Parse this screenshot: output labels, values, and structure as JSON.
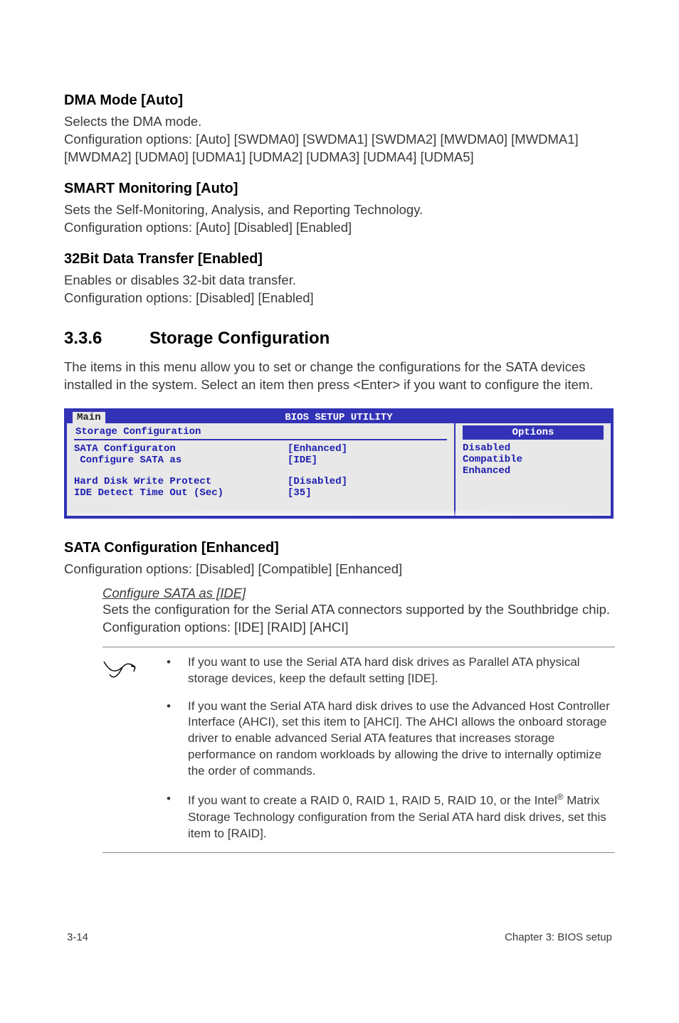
{
  "headings": {
    "dma": "DMA Mode [Auto]",
    "smart": "SMART Monitoring [Auto]",
    "bit32": "32Bit Data Transfer [Enabled]",
    "section_num": "3.3.6",
    "section_title": "Storage Configuration",
    "sata_conf": "SATA Configuration [Enhanced]"
  },
  "paras": {
    "dma1": "Selects the DMA mode.",
    "dma2": "Configuration options: [Auto] [SWDMA0] [SWDMA1] [SWDMA2] [MWDMA0] [MWDMA1] [MWDMA2] [UDMA0] [UDMA1] [UDMA2] [UDMA3] [UDMA4] [UDMA5]",
    "smart1": "Sets the Self-Monitoring, Analysis, and Reporting Technology.",
    "smart2": "Configuration options: [Auto] [Disabled] [Enabled]",
    "bit1": "Enables or disables 32-bit data transfer.",
    "bit2": "Configuration options: [Disabled] [Enabled]",
    "section_intro": "The items in this menu allow you to set or change the configurations for the SATA devices installed in the system. Select an item then press <Enter> if you want to configure the item.",
    "sata_conf_opts": "Configuration options: [Disabled] [Compatible] [Enhanced]",
    "conf_sata_title": "Configure SATA as [IDE]",
    "conf_sata_body": "Sets the configuration for the Serial ATA connectors supported by the Southbridge chip. Configuration options: [IDE] [RAID] [AHCI]"
  },
  "bios": {
    "title": "BIOS SETUP UTILITY",
    "tab": "Main",
    "left_heading": "Storage Configuration",
    "options_label": "Options",
    "rows": [
      {
        "label": "SATA Configuraton",
        "value": "[Enhanced]"
      },
      {
        "label": " Configure SATA as",
        "value": "[IDE]"
      },
      {
        "label": "Hard Disk Write Protect",
        "value": "[Disabled]"
      },
      {
        "label": "IDE Detect Time Out (Sec)",
        "value": "[35]"
      }
    ],
    "right_items": [
      "Disabled",
      "Compatible",
      "Enhanced"
    ]
  },
  "notes": {
    "items": [
      "If you want to use the Serial ATA hard disk drives as Parallel ATA physical storage devices, keep the default setting [IDE].",
      "If you want the Serial ATA hard disk drives to use the Advanced Host Controller Interface (AHCI), set this item to [AHCI]. The AHCI allows the onboard storage driver to enable advanced Serial ATA features that increases storage performance on random workloads by allowing the drive to internally optimize the order of commands.",
      "If you want to create a RAID 0, RAID 1, RAID 5, RAID 10, or the Intel® Matrix Storage Technology configuration from the Serial ATA hard disk drives, set this item to [RAID]."
    ]
  },
  "footer": {
    "left": "3-14",
    "right": "Chapter 3: BIOS setup"
  }
}
